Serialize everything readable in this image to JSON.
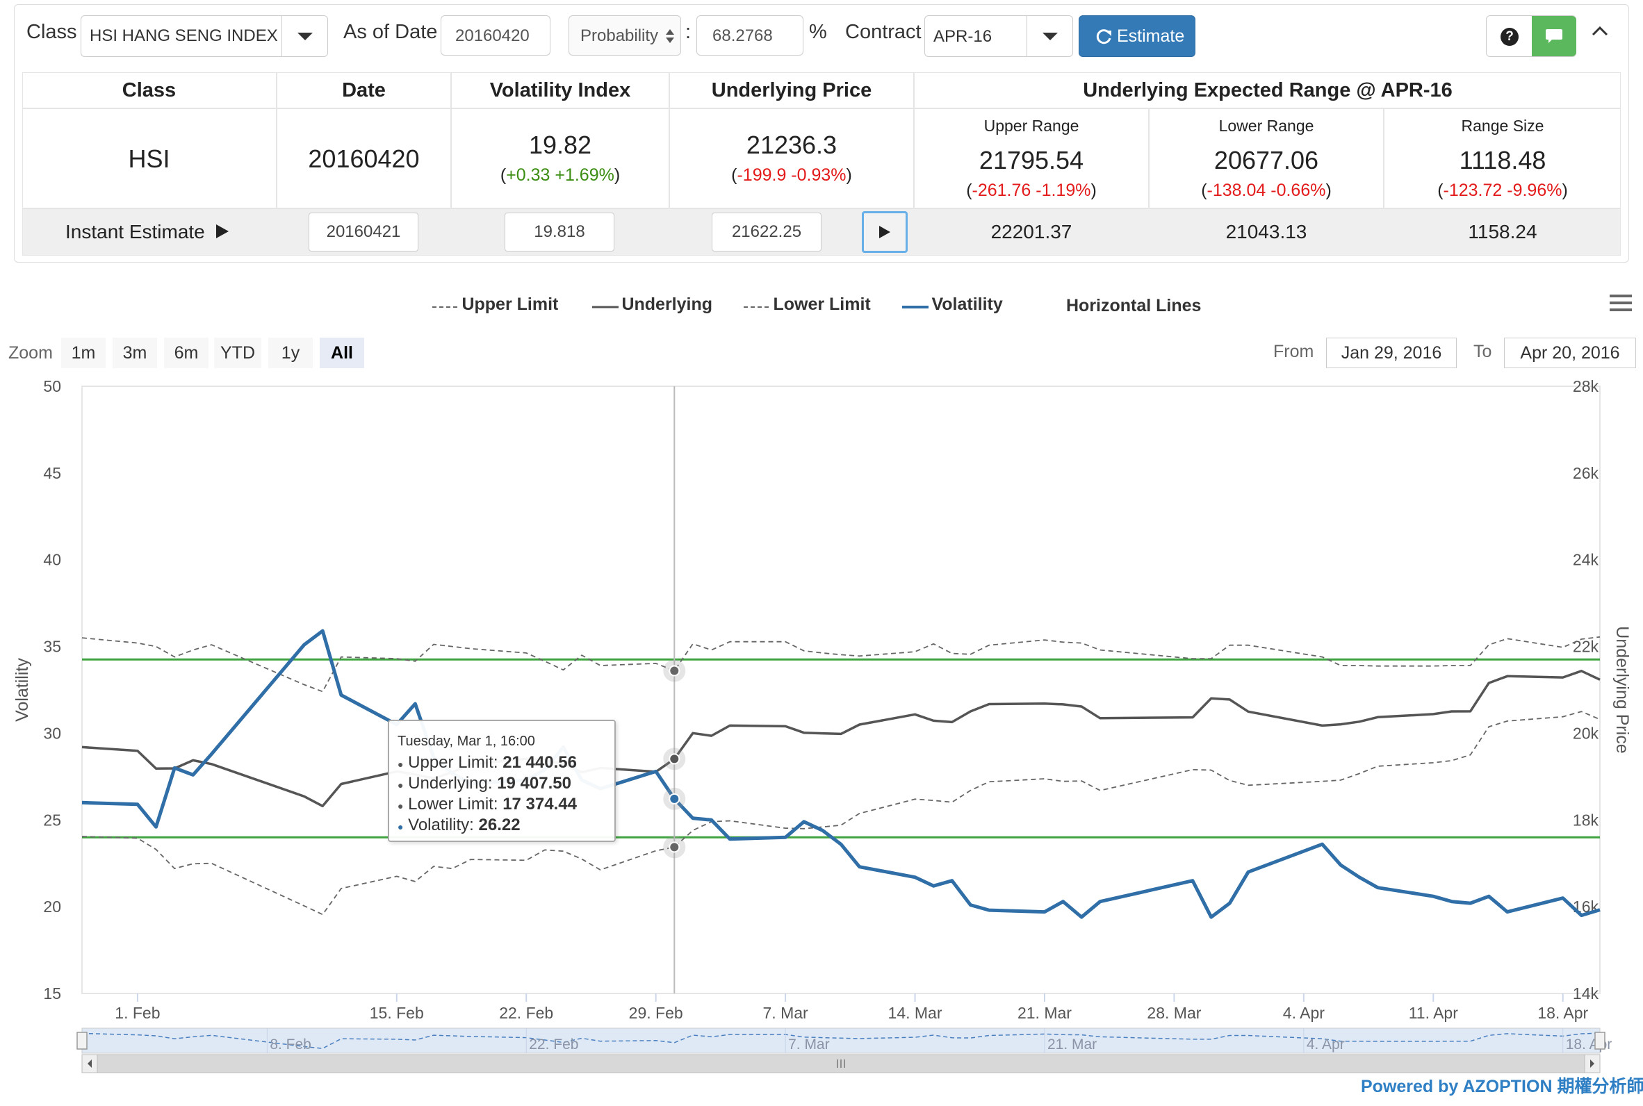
{
  "toolbar": {
    "class_label": "Class",
    "class_value": "HSI HANG SENG INDEX",
    "as_of_label": "As of Date",
    "as_of_value": "20160420",
    "probability_select": "Probability",
    "colon": ":",
    "probability_value": "68.2768",
    "percent": "%",
    "contract_label": "Contract",
    "contract_value": "APR-16",
    "estimate_label": "Estimate",
    "help_icon": "?",
    "chat_icon": "speech-bubble",
    "collapse_icon": "chevron-up"
  },
  "table": {
    "headers": {
      "class": "Class",
      "date": "Date",
      "volatility": "Volatility Index",
      "underlying": "Underlying Price",
      "range": "Underlying Expected Range @ APR-16"
    },
    "subheaders": {
      "upper": "Upper Range",
      "lower": "Lower Range",
      "size": "Range Size"
    },
    "row": {
      "class": "HSI",
      "date": "20160420",
      "vol": "19.82",
      "vol_change": "+0.33 +1.69%",
      "price": "21236.3",
      "price_change": "-199.9 -0.93%",
      "upper": "21795.54",
      "upper_change": "-261.76 -1.19%",
      "lower": "20677.06",
      "lower_change": "-138.04 -0.66%",
      "size": "1118.48",
      "size_change": "-123.72 -9.96%"
    },
    "instant": {
      "label": "Instant Estimate",
      "date": "20160421",
      "vol": "19.818",
      "price": "21622.25",
      "upper": "22201.37",
      "lower": "21043.13",
      "size": "1158.24"
    }
  },
  "legend": {
    "upper": "Upper Limit",
    "underlying": "Underlying",
    "lower": "Lower Limit",
    "volatility": "Volatility",
    "hlines": "Horizontal Lines"
  },
  "zoom": {
    "label": "Zoom",
    "buttons": [
      "1m",
      "3m",
      "6m",
      "YTD",
      "1y",
      "All"
    ],
    "active": "All",
    "from_label": "From",
    "from_value": "Jan 29, 2016",
    "to_label": "To",
    "to_value": "Apr 20, 2016"
  },
  "tooltip": {
    "title": "Tuesday, Mar 1, 16:00",
    "rows": [
      {
        "label": "Upper Limit: ",
        "value": "21 440.56",
        "color": "#555555"
      },
      {
        "label": "Underlying: ",
        "value": "19 407.50",
        "color": "#555555"
      },
      {
        "label": "Lower Limit: ",
        "value": "17 374.44",
        "color": "#555555"
      },
      {
        "label": "Volatility: ",
        "value": "26.22",
        "color": "#2f6ea6"
      }
    ]
  },
  "footer": {
    "powered": "Powered by AZOPTION 期權分析師"
  },
  "chart_data": {
    "type": "line",
    "x_ticks": [
      "1. Feb",
      "15. Feb",
      "22. Feb",
      "29. Feb",
      "7. Mar",
      "14. Mar",
      "21. Mar",
      "28. Mar",
      "4. Apr",
      "11. Apr",
      "18. Apr"
    ],
    "navigator_ticks": [
      "8. Feb",
      "22. Feb",
      "7. Mar",
      "21. Mar",
      "4. Apr",
      "18. Apr"
    ],
    "y_left": {
      "label": "Volatility",
      "ticks": [
        15,
        20,
        25,
        30,
        35,
        40,
        45,
        50
      ],
      "range": [
        15,
        50
      ]
    },
    "y_right": {
      "label": "Underlying Price",
      "ticks": [
        "14k",
        "16k",
        "18k",
        "20k",
        "22k",
        "24k",
        "26k",
        "28k"
      ],
      "range": [
        14000,
        28000
      ]
    },
    "horizontal_lines": [
      {
        "axis": "right",
        "value": 21700,
        "color": "#3fa33f"
      },
      {
        "axis": "right",
        "value": 17600,
        "color": "#3fa33f"
      }
    ],
    "x_range": [
      "2016-01-29",
      "2016-04-20"
    ],
    "series": [
      {
        "name": "Volatility",
        "axis": "left",
        "color": "#2f6ea6",
        "style": "solid",
        "x": [
          "2016-01-29",
          "2016-02-01",
          "2016-02-02",
          "2016-02-03",
          "2016-02-04",
          "2016-02-05",
          "2016-02-10",
          "2016-02-11",
          "2016-02-12",
          "2016-02-15",
          "2016-02-16",
          "2016-02-17",
          "2016-02-18",
          "2016-02-19",
          "2016-02-22",
          "2016-02-23",
          "2016-02-24",
          "2016-02-25",
          "2016-02-26",
          "2016-02-29",
          "2016-03-01",
          "2016-03-02",
          "2016-03-03",
          "2016-03-04",
          "2016-03-07",
          "2016-03-08",
          "2016-03-09",
          "2016-03-10",
          "2016-03-11",
          "2016-03-14",
          "2016-03-15",
          "2016-03-16",
          "2016-03-17",
          "2016-03-18",
          "2016-03-21",
          "2016-03-22",
          "2016-03-23",
          "2016-03-24",
          "2016-03-29",
          "2016-03-30",
          "2016-03-31",
          "2016-04-01",
          "2016-04-05",
          "2016-04-06",
          "2016-04-07",
          "2016-04-08",
          "2016-04-11",
          "2016-04-12",
          "2016-04-13",
          "2016-04-14",
          "2016-04-15",
          "2016-04-18",
          "2016-04-19",
          "2016-04-20"
        ],
        "y": [
          26.0,
          25.9,
          24.6,
          28.0,
          27.6,
          28.8,
          35.1,
          35.9,
          32.2,
          30.5,
          31.7,
          28.6,
          27.7,
          27.1,
          27.3,
          27.9,
          29.2,
          27.3,
          26.8,
          27.8,
          26.22,
          25.1,
          25.0,
          23.9,
          24.0,
          24.9,
          24.4,
          23.6,
          22.3,
          21.7,
          21.2,
          21.5,
          20.1,
          19.8,
          19.7,
          20.3,
          19.4,
          20.3,
          21.5,
          19.4,
          20.2,
          22.0,
          23.6,
          22.4,
          21.7,
          21.1,
          20.6,
          20.3,
          20.2,
          20.6,
          19.7,
          20.5,
          19.5,
          19.82
        ]
      },
      {
        "name": "Underlying",
        "axis": "right",
        "color": "#555555",
        "style": "solid",
        "x": [
          "2016-01-29",
          "2016-02-01",
          "2016-02-02",
          "2016-02-03",
          "2016-02-04",
          "2016-02-05",
          "2016-02-10",
          "2016-02-11",
          "2016-02-12",
          "2016-02-15",
          "2016-02-16",
          "2016-02-17",
          "2016-02-18",
          "2016-02-19",
          "2016-02-22",
          "2016-02-23",
          "2016-02-24",
          "2016-02-25",
          "2016-02-26",
          "2016-02-29",
          "2016-03-01",
          "2016-03-02",
          "2016-03-03",
          "2016-03-04",
          "2016-03-07",
          "2016-03-08",
          "2016-03-09",
          "2016-03-10",
          "2016-03-11",
          "2016-03-14",
          "2016-03-15",
          "2016-03-16",
          "2016-03-17",
          "2016-03-18",
          "2016-03-21",
          "2016-03-22",
          "2016-03-23",
          "2016-03-24",
          "2016-03-29",
          "2016-03-30",
          "2016-03-31",
          "2016-04-01",
          "2016-04-05",
          "2016-04-06",
          "2016-04-07",
          "2016-04-08",
          "2016-04-11",
          "2016-04-12",
          "2016-04-13",
          "2016-04-14",
          "2016-04-15",
          "2016-04-18",
          "2016-04-19",
          "2016-04-20"
        ],
        "y": [
          19680,
          19595,
          19185,
          19190,
          19375,
          19290,
          18545,
          18320,
          18830,
          19120,
          19050,
          18960,
          19100,
          19285,
          19410,
          19380,
          19290,
          19100,
          19200,
          19111,
          19407.5,
          20002,
          19941,
          20176,
          20160,
          20012,
          19997,
          19984,
          20199,
          20435,
          20288,
          20257,
          20504,
          20671,
          20684,
          20666,
          20615,
          20346,
          20366,
          20804,
          20777,
          20498,
          20177,
          20206,
          20266,
          20370,
          20441,
          20504,
          20505,
          21158,
          21316,
          21286,
          21436,
          21236
        ]
      },
      {
        "name": "Upper Limit",
        "axis": "right",
        "color": "#666666",
        "style": "dashed",
        "x": [
          "2016-01-29",
          "2016-02-01",
          "2016-02-02",
          "2016-02-03",
          "2016-02-04",
          "2016-02-05",
          "2016-02-10",
          "2016-02-11",
          "2016-02-12",
          "2016-02-15",
          "2016-02-16",
          "2016-02-17",
          "2016-02-18",
          "2016-02-19",
          "2016-02-22",
          "2016-02-23",
          "2016-02-24",
          "2016-02-25",
          "2016-02-26",
          "2016-02-29",
          "2016-03-01",
          "2016-03-02",
          "2016-03-03",
          "2016-03-04",
          "2016-03-07",
          "2016-03-08",
          "2016-03-09",
          "2016-03-10",
          "2016-03-11",
          "2016-03-14",
          "2016-03-15",
          "2016-03-16",
          "2016-03-17",
          "2016-03-18",
          "2016-03-21",
          "2016-03-22",
          "2016-03-23",
          "2016-03-24",
          "2016-03-29",
          "2016-03-30",
          "2016-03-31",
          "2016-04-01",
          "2016-04-05",
          "2016-04-06",
          "2016-04-07",
          "2016-04-08",
          "2016-04-11",
          "2016-04-12",
          "2016-04-13",
          "2016-04-14",
          "2016-04-15",
          "2016-04-18",
          "2016-04-19",
          "2016-04-20"
        ],
        "y": [
          22200,
          22080,
          22000,
          21760,
          21920,
          22040,
          21120,
          20960,
          21760,
          21720,
          21660,
          22050,
          22000,
          21950,
          21850,
          21660,
          21460,
          21800,
          21560,
          21610,
          21440.56,
          22060,
          21920,
          22110,
          22110,
          21900,
          21850,
          21810,
          21780,
          21880,
          22060,
          21840,
          21820,
          22030,
          22150,
          22100,
          22080,
          21920,
          21720,
          21720,
          22030,
          22030,
          21760,
          21560,
          21560,
          21550,
          21550,
          21560,
          21560,
          22040,
          22180,
          21980,
          22170,
          22220
        ]
      },
      {
        "name": "Lower Limit",
        "axis": "right",
        "color": "#666666",
        "style": "dashed",
        "x": [
          "2016-01-29",
          "2016-02-01",
          "2016-02-02",
          "2016-02-03",
          "2016-02-04",
          "2016-02-05",
          "2016-02-10",
          "2016-02-11",
          "2016-02-12",
          "2016-02-15",
          "2016-02-16",
          "2016-02-17",
          "2016-02-18",
          "2016-02-19",
          "2016-02-22",
          "2016-02-23",
          "2016-02-24",
          "2016-02-25",
          "2016-02-26",
          "2016-02-29",
          "2016-03-01",
          "2016-03-02",
          "2016-03-03",
          "2016-03-04",
          "2016-03-07",
          "2016-03-08",
          "2016-03-09",
          "2016-03-10",
          "2016-03-11",
          "2016-03-14",
          "2016-03-15",
          "2016-03-16",
          "2016-03-17",
          "2016-03-18",
          "2016-03-21",
          "2016-03-22",
          "2016-03-23",
          "2016-03-24",
          "2016-03-29",
          "2016-03-30",
          "2016-03-31",
          "2016-04-01",
          "2016-04-05",
          "2016-04-06",
          "2016-04-07",
          "2016-04-08",
          "2016-04-11",
          "2016-04-12",
          "2016-04-13",
          "2016-04-14",
          "2016-04-15",
          "2016-04-18",
          "2016-04-19",
          "2016-04-20"
        ],
        "y": [
          17620,
          17580,
          17320,
          16880,
          16990,
          17000,
          16020,
          15820,
          16420,
          16700,
          16580,
          16930,
          16880,
          17090,
          17070,
          17310,
          17280,
          17100,
          16850,
          17290,
          17374.44,
          17760,
          17960,
          17980,
          17810,
          17800,
          17840,
          17880,
          18150,
          18480,
          18450,
          18410,
          18680,
          18880,
          18950,
          18890,
          18900,
          18680,
          19160,
          19150,
          18910,
          18800,
          18890,
          18920,
          19070,
          19240,
          19320,
          19370,
          19500,
          20150,
          20280,
          20380,
          20500,
          20320
        ]
      }
    ],
    "navigator": {
      "series": "Upper Limit"
    }
  }
}
